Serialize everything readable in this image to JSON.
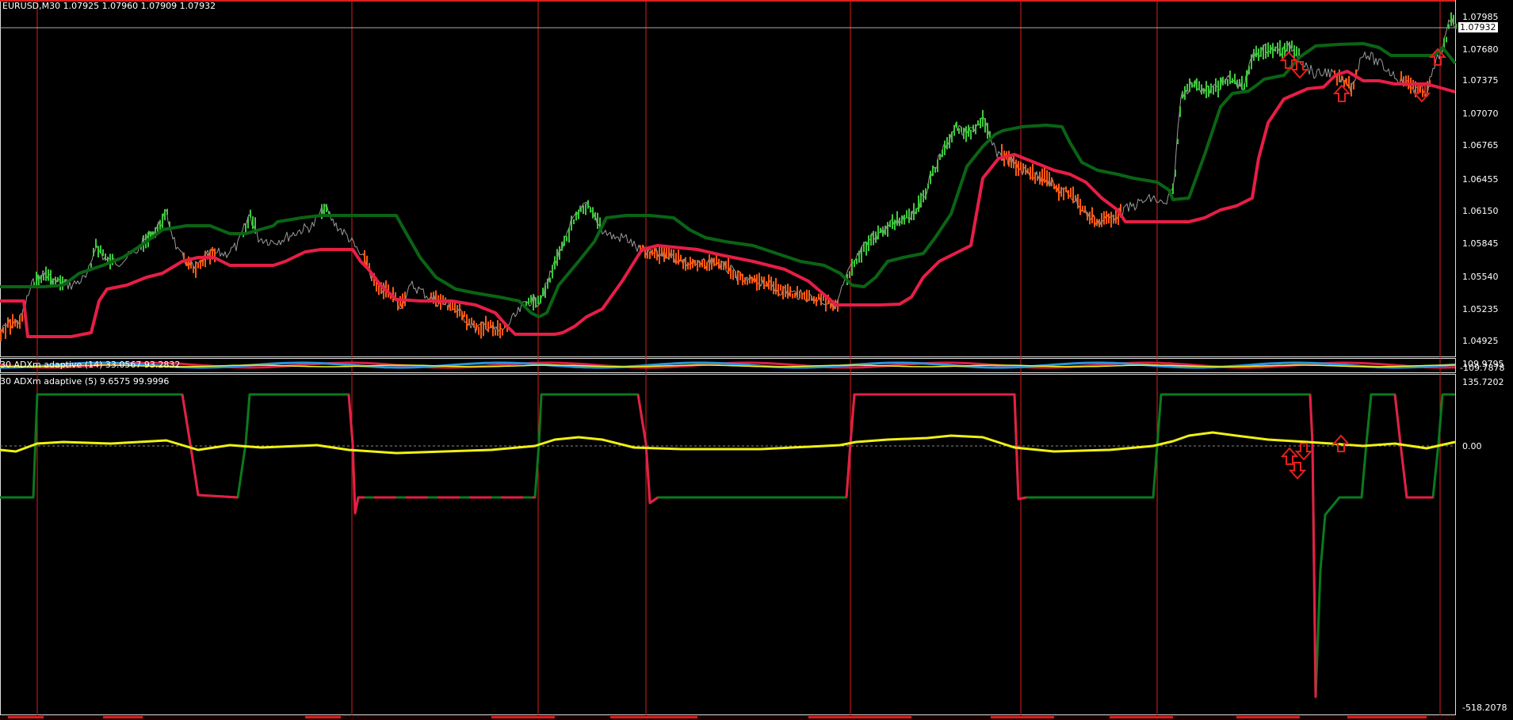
{
  "main_chart": {
    "header": "EURUSD,M30  1.07925 1.07960 1.07909 1.07932",
    "current_price": "1.07932",
    "price_labels": [
      "1.07985",
      "1.07680",
      "1.07375",
      "1.07070",
      "1.06765",
      "1.06455",
      "1.06150",
      "1.05845",
      "1.05540",
      "1.05235",
      "1.04925"
    ]
  },
  "indicator_1": {
    "header": "30 ADXm adaptive (14) 33.0567 93.2832",
    "scale_labels": [
      "109.9795",
      "-109.7878"
    ]
  },
  "indicator_2": {
    "header": "30 ADXm adaptive (5) 9.6575 99.9996",
    "scale_labels": [
      "135.7202",
      "0.00",
      "-518.2078"
    ]
  },
  "colors": {
    "background": "#000000",
    "up_candle": "#3cc83c",
    "down_candle": "#ff5a14",
    "upper_band": "#0a6414",
    "lower_band": "#e61e46",
    "adx_line": "#f0f014",
    "period_separator": "#dc1e1e",
    "signal_arrow": "#e61e1e"
  }
}
